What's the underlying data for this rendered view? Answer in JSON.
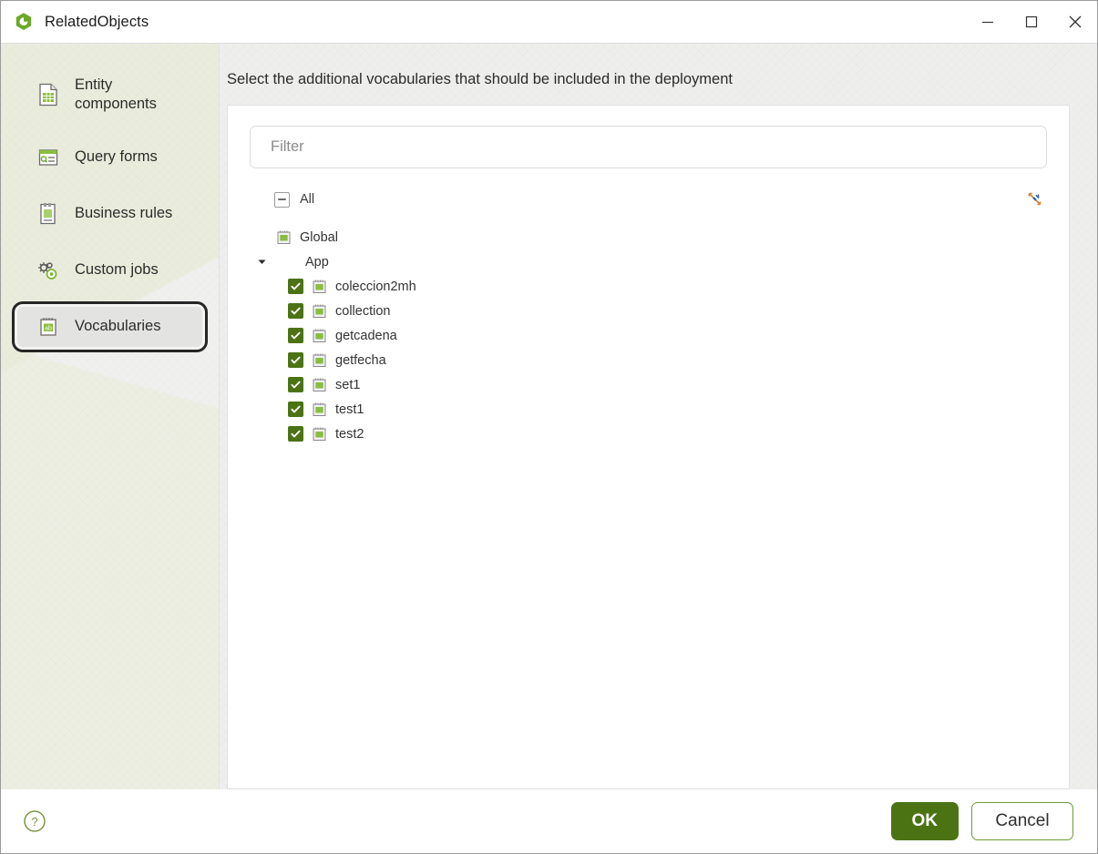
{
  "window": {
    "title": "RelatedObjects",
    "app_icon": "hexagon-clock-icon",
    "controls": {
      "minimize": "minimize-icon",
      "maximize": "maximize-icon",
      "close": "close-icon"
    }
  },
  "sidebar": {
    "items": [
      {
        "label": "Entity components",
        "icon": "entity-components-icon",
        "selected": false
      },
      {
        "label": "Query forms",
        "icon": "query-forms-icon",
        "selected": false
      },
      {
        "label": "Business rules",
        "icon": "business-rules-icon",
        "selected": false
      },
      {
        "label": "Custom jobs",
        "icon": "custom-jobs-gear-icon",
        "selected": false
      },
      {
        "label": "Vocabularies",
        "icon": "vocabularies-icon",
        "selected": true
      }
    ]
  },
  "main": {
    "instruction": "Select the additional vocabularies that should be included in the deployment",
    "filter": {
      "placeholder": "Filter",
      "value": ""
    },
    "all_row": {
      "label": "All",
      "checkbox_state": "indeterminate",
      "collapse_all_icon": "collapse-all-icon"
    },
    "tree": [
      {
        "label": "Global",
        "level": 0,
        "icon": "vocabulary-icon",
        "checkbox": null,
        "caret": null
      },
      {
        "label": "App",
        "level": 1,
        "icon": null,
        "checkbox": null,
        "caret": "expanded"
      },
      {
        "label": "coleccion2mh",
        "level": 2,
        "icon": "vocabulary-icon",
        "checkbox": "checked",
        "caret": null
      },
      {
        "label": "collection",
        "level": 2,
        "icon": "vocabulary-icon",
        "checkbox": "checked",
        "caret": null
      },
      {
        "label": "getcadena",
        "level": 2,
        "icon": "vocabulary-icon",
        "checkbox": "checked",
        "caret": null
      },
      {
        "label": "getfecha",
        "level": 2,
        "icon": "vocabulary-icon",
        "checkbox": "checked",
        "caret": null
      },
      {
        "label": "set1",
        "level": 2,
        "icon": "vocabulary-icon",
        "checkbox": "checked",
        "caret": null
      },
      {
        "label": "test1",
        "level": 2,
        "icon": "vocabulary-icon",
        "checkbox": "checked",
        "caret": null
      },
      {
        "label": "test2",
        "level": 2,
        "icon": "vocabulary-icon",
        "checkbox": "checked",
        "caret": null
      }
    ]
  },
  "footer": {
    "help_icon": "help-circle-icon",
    "ok_label": "OK",
    "cancel_label": "Cancel"
  },
  "colors": {
    "accent_green": "#4b7314",
    "accent_green_light": "#8bbd3f",
    "cancel_border": "#6f9a36",
    "sidebar_bg": "#e9ecdb",
    "panel_bg": "#ffffff"
  }
}
